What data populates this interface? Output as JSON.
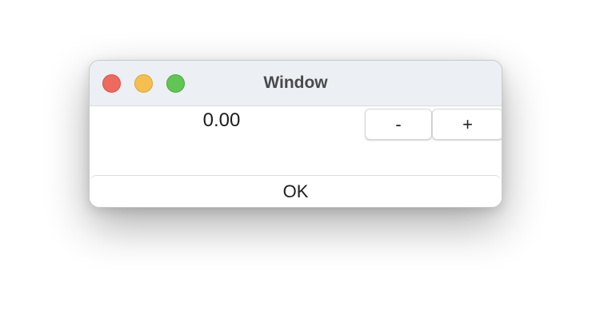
{
  "window": {
    "title": "Window"
  },
  "traffic_lights": {
    "close_color": "#ee6a5f",
    "minimize_color": "#f5bf4f",
    "zoom_color": "#61c554"
  },
  "stepper": {
    "value": "0.00",
    "decrement_label": "-",
    "increment_label": "+"
  },
  "footer": {
    "ok_label": "OK"
  }
}
